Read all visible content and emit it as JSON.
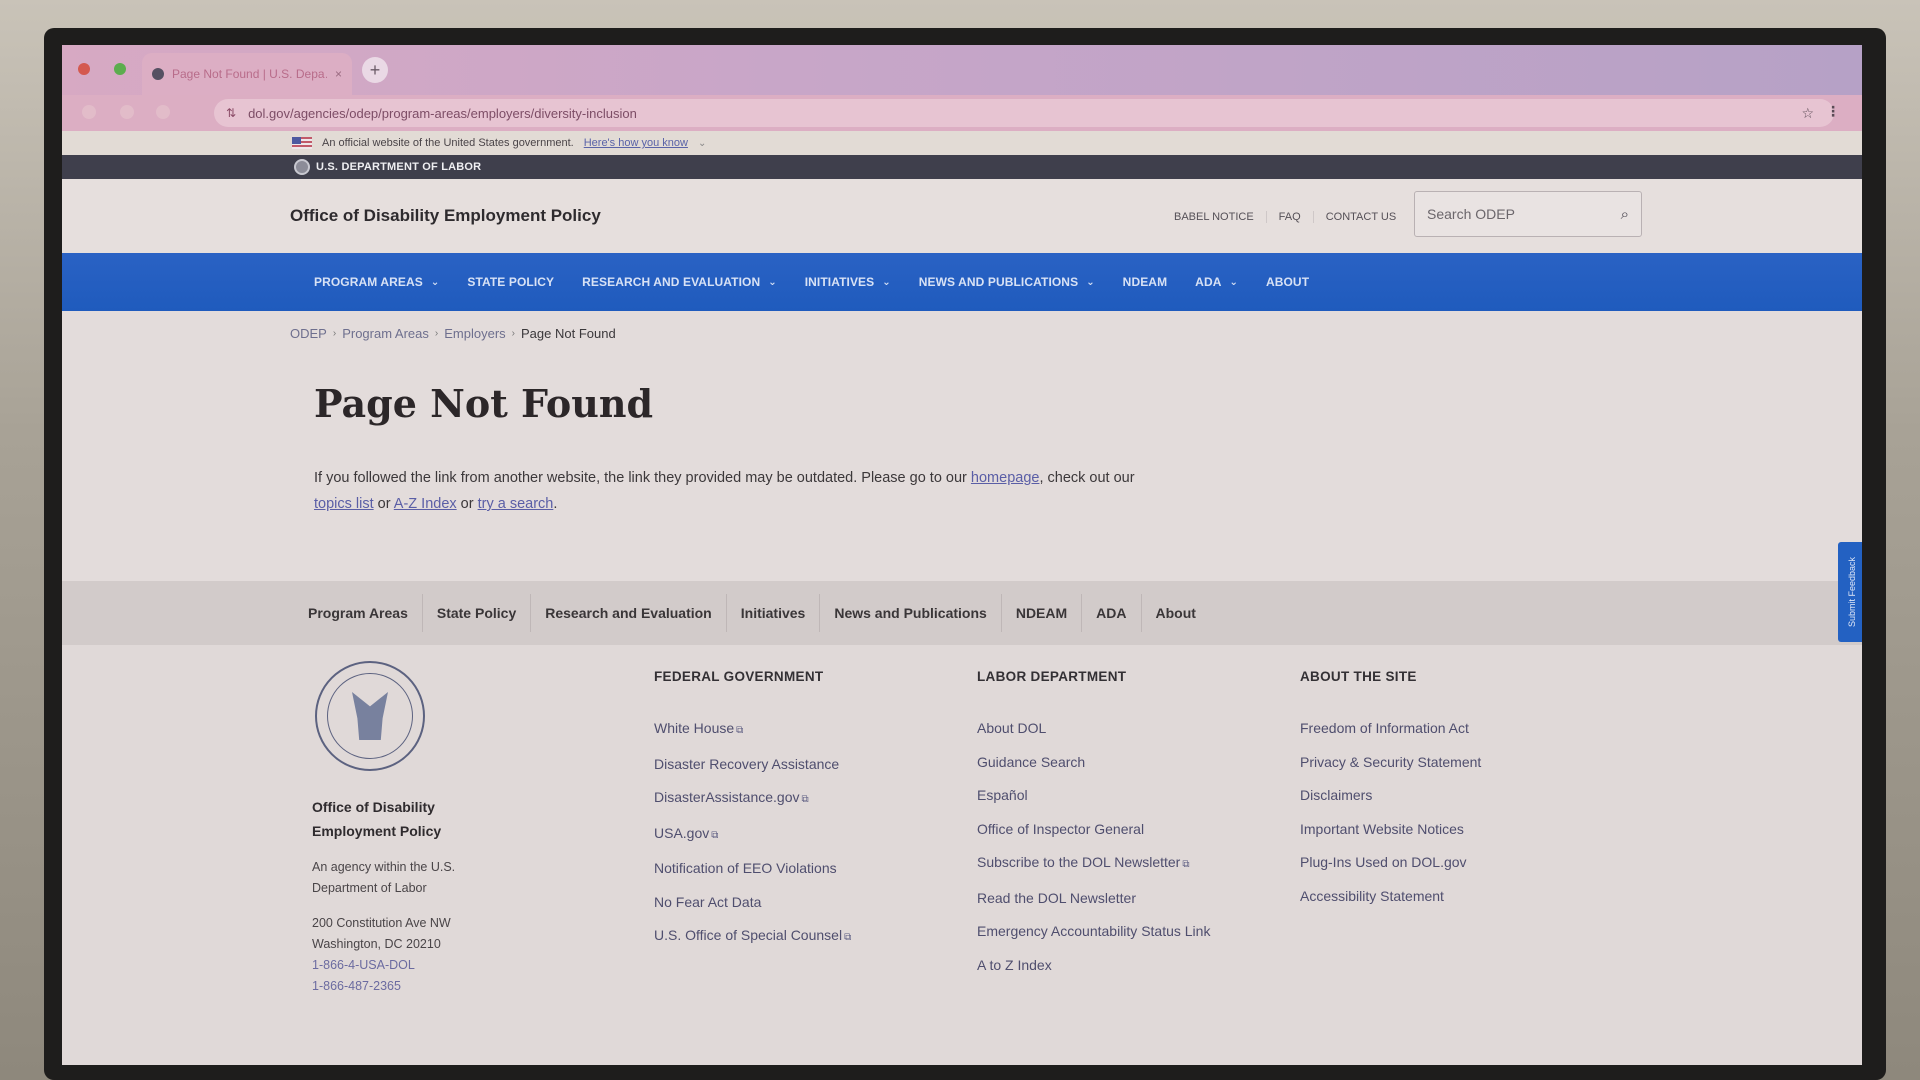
{
  "browser": {
    "tab_title": "Page Not Found | U.S. Depa…",
    "url": "dol.gov/agencies/odep/program-areas/employers/diversity-inclusion",
    "new_tab_symbol": "+",
    "close_symbol": "×",
    "icons": {
      "site_info": "⇅",
      "star": "☆",
      "menu": "⋮"
    }
  },
  "gov_banner": {
    "text": "An official website of the United States government.",
    "link": "Here's how you know",
    "chevron": "⌄"
  },
  "dol_bar": {
    "text": "U.S. DEPARTMENT OF LABOR"
  },
  "header": {
    "site_title": "Office of Disability Employment Policy",
    "util_links": [
      "BABEL NOTICE",
      "FAQ",
      "CONTACT US"
    ],
    "search_placeholder": "Search ODEP",
    "search_icon": "⌕"
  },
  "main_nav": [
    {
      "label": "PROGRAM AREAS",
      "has_dropdown": true
    },
    {
      "label": "STATE POLICY",
      "has_dropdown": false
    },
    {
      "label": "RESEARCH AND EVALUATION",
      "has_dropdown": true
    },
    {
      "label": "INITIATIVES",
      "has_dropdown": true
    },
    {
      "label": "NEWS AND PUBLICATIONS",
      "has_dropdown": true
    },
    {
      "label": "NDEAM",
      "has_dropdown": false
    },
    {
      "label": "ADA",
      "has_dropdown": true
    },
    {
      "label": "ABOUT",
      "has_dropdown": false
    }
  ],
  "chevron_glyph": "⌄",
  "breadcrumb": {
    "items": [
      "ODEP",
      "Program Areas",
      "Employers"
    ],
    "current": "Page Not Found",
    "separator": "›"
  },
  "page": {
    "title": "Page Not Found",
    "text_1": "If you followed the link from another website, the link they provided may be outdated. Please go to our ",
    "link_homepage": "homepage",
    "text_2": ", check out our ",
    "link_topics": "topics list",
    "text_3": " or ",
    "link_az": "A-Z Index",
    "text_4": " or ",
    "link_search": "try a search",
    "text_5": "."
  },
  "sub_nav": [
    "Program Areas",
    "State Policy",
    "Research and Evaluation",
    "Initiatives",
    "News and Publications",
    "NDEAM",
    "ADA",
    "About"
  ],
  "footer": {
    "agency_name": "Office of Disability Employment Policy",
    "agency_desc": "An agency within the U.S. Department of Labor",
    "address_1": "200 Constitution Ave NW",
    "address_2": "Washington, DC 20210",
    "phone_1": "1-866-4-USA-DOL",
    "phone_2": "1-866-487-2365",
    "external_icon": "⧉",
    "columns": [
      {
        "title": "FEDERAL GOVERNMENT",
        "links": [
          {
            "label": "White House",
            "external": true
          },
          {
            "label": "Disaster Recovery Assistance",
            "external": false
          },
          {
            "label": "DisasterAssistance.gov",
            "external": true
          },
          {
            "label": "USA.gov",
            "external": true
          },
          {
            "label": "Notification of EEO Violations",
            "external": false
          },
          {
            "label": "No Fear Act Data",
            "external": false
          },
          {
            "label": "U.S. Office of Special Counsel",
            "external": true
          }
        ]
      },
      {
        "title": "LABOR DEPARTMENT",
        "links": [
          {
            "label": "About DOL",
            "external": false
          },
          {
            "label": "Guidance Search",
            "external": false
          },
          {
            "label": "Español",
            "external": false
          },
          {
            "label": "Office of Inspector General",
            "external": false
          },
          {
            "label": "Subscribe to the DOL Newsletter",
            "external": true
          },
          {
            "label": "Read the DOL Newsletter",
            "external": false
          },
          {
            "label": "Emergency Accountability Status Link",
            "external": false
          },
          {
            "label": "A to Z Index",
            "external": false
          }
        ]
      },
      {
        "title": "ABOUT THE SITE",
        "links": [
          {
            "label": "Freedom of Information Act",
            "external": false
          },
          {
            "label": "Privacy & Security Statement",
            "external": false
          },
          {
            "label": "Disclaimers",
            "external": false
          },
          {
            "label": "Important Website Notices",
            "external": false
          },
          {
            "label": "Plug-Ins Used on DOL.gov",
            "external": false
          },
          {
            "label": "Accessibility Statement",
            "external": false
          }
        ]
      }
    ]
  },
  "feedback_tab": {
    "label": "Submit Feedback"
  },
  "colors": {
    "nav_blue": "#1f5bbd",
    "dol_bar": "#3f3f4c",
    "link": "#5a5ea6",
    "sub_nav_bg": "#d2cbca"
  }
}
